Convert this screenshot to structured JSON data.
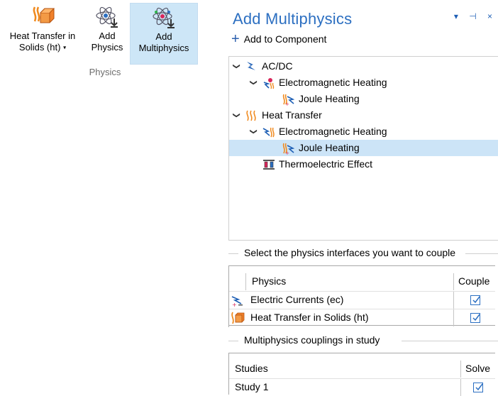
{
  "ribbon": {
    "buttons": [
      {
        "line1": "Heat Transfer in",
        "line2": "Solids (ht)",
        "has_dropdown": true,
        "icon": "heat-transfer-solids-icon"
      },
      {
        "line1": "Add",
        "line2": "Physics",
        "icon": "atom-add-physics-icon"
      },
      {
        "line1": "Add",
        "line2": "Multiphysics",
        "icon": "atom-add-multiphysics-icon"
      }
    ],
    "dropdown_glyph": "▾",
    "group_label": "Physics"
  },
  "panel": {
    "title": "Add Multiphysics",
    "tools": "▾ ⊣ ×",
    "add_to_component": "Add to Component",
    "tree": [
      {
        "label": "AC/DC",
        "level": 0,
        "expanded": true,
        "icon": "acdc-bolt-icon"
      },
      {
        "label": "Electromagnetic Heating",
        "level": 1,
        "expanded": true,
        "icon": "electromagnetic-heating-icon"
      },
      {
        "label": "Joule Heating",
        "level": 2,
        "icon": "joule-heating-icon"
      },
      {
        "label": "Heat Transfer",
        "level": 0,
        "expanded": true,
        "icon": "heat-transfer-icon"
      },
      {
        "label": "Electromagnetic Heating",
        "level": 1,
        "expanded": true,
        "icon": "electromagnetic-heating-icon"
      },
      {
        "label": "Joule Heating",
        "level": 2,
        "selected": true,
        "icon": "joule-heating-icon"
      },
      {
        "label": "Thermoelectric Effect",
        "level": 1,
        "icon": "thermoelectric-effect-icon"
      }
    ],
    "couple_section": {
      "title": "Select the physics interfaces you want to couple",
      "headers": [
        "Physics",
        "Couple"
      ],
      "rows": [
        {
          "physics": "Electric Currents (ec)",
          "couple": true,
          "icon": "electric-currents-icon"
        },
        {
          "physics": "Heat Transfer in Solids (ht)",
          "couple": true,
          "icon": "heat-transfer-solids-icon"
        }
      ]
    },
    "studies_section": {
      "title": "Multiphysics couplings in study",
      "headers": [
        "Studies",
        "Solve"
      ],
      "rows": [
        {
          "study": "Study 1",
          "solve": true
        }
      ]
    }
  },
  "colors": {
    "accent": "#2c6fc1",
    "selection": "#cce4f7",
    "ribbon_selected": "#cde6f7",
    "heat_orange": "#f07a1b",
    "bolt_blue": "#1e5fb5"
  }
}
